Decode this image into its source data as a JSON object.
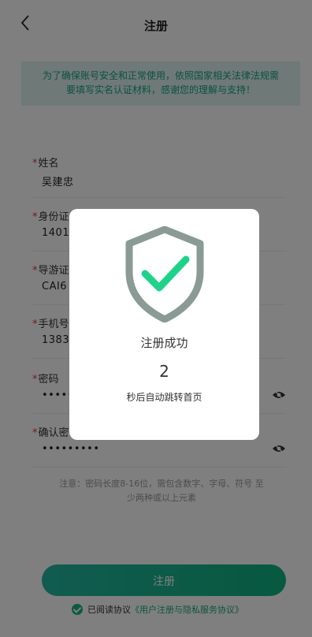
{
  "nav": {
    "title": "注册",
    "back_icon": "chevron-left-icon"
  },
  "notice": {
    "line1": "为了确保账号安全和正常使用，依照国家相关法律法规需",
    "line2": "要填写实名认证材料，感谢您的理解与支持！"
  },
  "fields": [
    {
      "label": "姓名",
      "value": "吴建忠"
    },
    {
      "label": "身份证号",
      "value": "1401"
    },
    {
      "label": "导游证号",
      "value": "CAI6"
    },
    {
      "label": "手机号",
      "value": "1383"
    },
    {
      "label": "密码",
      "value": "••••••"
    },
    {
      "label": "确认密码",
      "value": "•••••••••"
    }
  ],
  "hint": {
    "line1": "注意：密码长度8-16位，需包含数字、字母、符号 至",
    "line2": "少两种或以上元素"
  },
  "submit_label": "注册",
  "agreement": {
    "prefix": "已阅读协议",
    "link": "《用户注册与隐私服务协议》",
    "checked": true
  },
  "modal": {
    "title": "注册成功",
    "countdown": "2",
    "subtitle": "秒后自动跳转首页",
    "icon": "shield-check-icon"
  },
  "colors": {
    "accent": "#1cb386",
    "required": "#e0383c",
    "notice_bg": "#dff3ef"
  }
}
